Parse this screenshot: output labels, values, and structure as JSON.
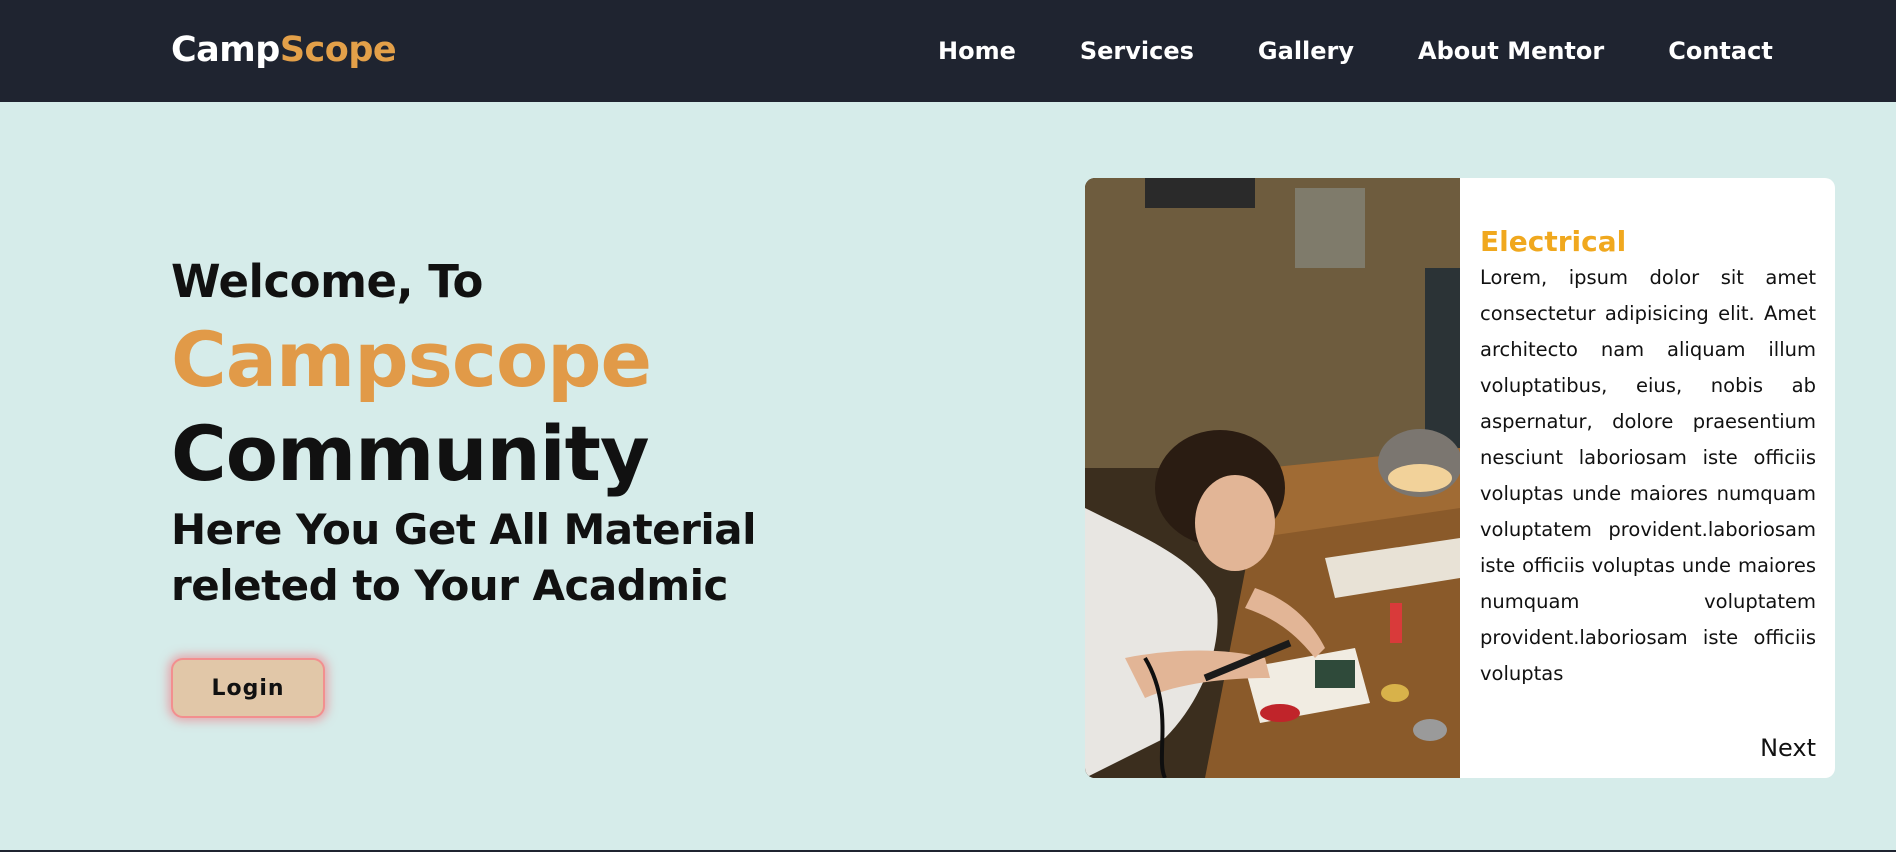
{
  "nav": {
    "logo_main": "Camp",
    "logo_accent": "Scope",
    "links": [
      "Home",
      "Services",
      "Gallery",
      "About Mentor",
      "Contact"
    ]
  },
  "hero": {
    "welcome": "Welcome, To",
    "brand": "Campscope",
    "community": "Community",
    "tagline": "Here You Get All Material releted to Your Acadmic",
    "login_label": "Login"
  },
  "card": {
    "image_alt": "",
    "title": "Electrical",
    "text": "Lorem, ipsum dolor sit amet consectetur adipisicing elit. Amet architecto nam aliquam illum voluptatibus, eius, nobis ab aspernatur, dolore praesentium nesciunt laboriosam iste officiis voluptas unde maiores numquam voluptatem provident.laboriosam iste officiis voluptas unde maiores numquam voluptatem provident.laboriosam iste officiis voluptas",
    "next_label": "Next"
  },
  "colors": {
    "nav_bg": "#1f2430",
    "page_bg": "#d6ecea",
    "brand_accent": "#e19a48",
    "card_title": "#f0a81e",
    "login_bg": "#e1c7a8"
  }
}
